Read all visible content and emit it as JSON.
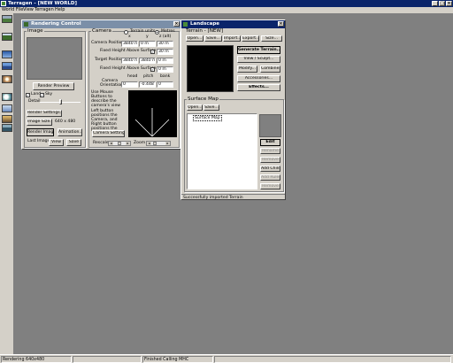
{
  "app": {
    "title": "Terragen - [NEW WORLD]"
  },
  "menu": [
    "World File",
    "View",
    "Terragen",
    "Help"
  ],
  "toolbar_icons": [
    "landscape-icon",
    "terrain-icon",
    "sky-icon",
    "water-icon",
    "sun-icon",
    "cloud-icon",
    "atmosphere-icon",
    "lighting-icon",
    "camera-icon"
  ],
  "rendering": {
    "title": "Rendering Control",
    "image": {
      "section": "Image",
      "render_preview": "Render Preview",
      "land_label": "Land",
      "sky_label": "Sky",
      "detail_label": "Detail",
      "render_settings": "Render Settings...",
      "image_size": "Image Size...",
      "image_size_value": "640 x 480",
      "render_image": "Render Image",
      "animation": "Animation...",
      "last_image_label": "Last Image",
      "view": "View",
      "save": "Save"
    },
    "camera": {
      "section": "Camera",
      "terrain_units": "Terrain units",
      "metres": "Metres",
      "col_x": "x",
      "col_y": "y",
      "col_z": "z (alt)",
      "camera_position_label": "Camera Position",
      "camera_position": [
        "3840 m",
        "0 m",
        "30 m"
      ],
      "fixed_height_label": "Fixed Height Above Surface",
      "fixed_height": "30 m",
      "target_position_label": "Target Position",
      "target_position": [
        "3840 m",
        "3840 m",
        "0 m"
      ],
      "target_fixed_label": "Fixed Height Above Surface",
      "target_fixed": "0 m",
      "col_head": "head",
      "col_pitch": "pitch",
      "col_bank": "bank",
      "orientation_label": "Camera Orientation",
      "orientation": [
        "0",
        "-0.448",
        "0"
      ],
      "help_text_1": "Use Mouse Buttons to describe the camera's view",
      "help_text_2": "Left button positions the Camera, and Right button positions the Target",
      "camera_settings": "Camera Settings...",
      "rescale_label": "Rescale",
      "zoom_label": "Zoom"
    }
  },
  "landscape": {
    "title": "Landscape",
    "terrain_section": "Terrain - [NEW]",
    "top_buttons": [
      "Open...",
      "Save...",
      "Import...",
      "Export...",
      "Size..."
    ],
    "right_buttons": [
      "Generate Terrain...",
      "View / Sculpt...",
      "Modify...",
      "Combine...",
      "Accessories...",
      "Effects..."
    ],
    "surface_section": "Surface Map",
    "open": "Open...",
    "save": "Save...",
    "surface_items": [
      "Surface Map"
    ],
    "side_buttons": [
      "Edit",
      "Rename",
      "Remove",
      "Add Child",
      "Add Rules",
      "Remove"
    ],
    "status": "Successfully imported Terrain"
  },
  "statusbar": [
    "Rendering 640x480",
    "",
    "Finished Calling MHC",
    ""
  ]
}
